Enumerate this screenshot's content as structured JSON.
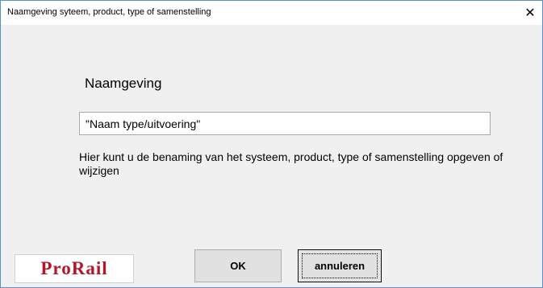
{
  "window": {
    "title": "Naamgeving syteem, product, type of samenstelling",
    "close_glyph": "✕"
  },
  "form": {
    "heading": "Naamgeving",
    "name_value": "\"Naam type/uitvoering\"",
    "help_text": "Hier kunt u de benaming van het systeem, product, type of samenstelling opgeven of wijzigen"
  },
  "buttons": {
    "ok_label": "OK",
    "cancel_label": "annuleren"
  },
  "logo": {
    "text": "ProRail",
    "color": "#b5152b"
  },
  "colors": {
    "dialog_background": "#f0f0f0",
    "window_border": "#5b8fc9"
  }
}
